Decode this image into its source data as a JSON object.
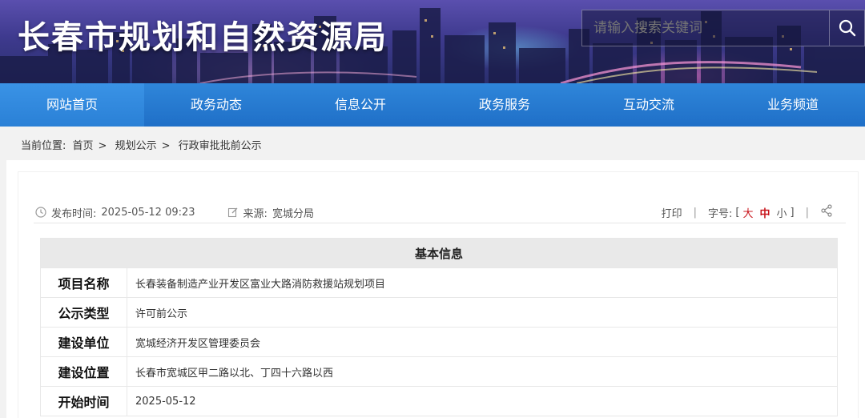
{
  "header": {
    "site_title": "长春市规划和自然资源局",
    "search_placeholder": "请输入搜索关键词"
  },
  "nav": {
    "items": [
      {
        "label": "网站首页",
        "active": true
      },
      {
        "label": "政务动态"
      },
      {
        "label": "信息公开"
      },
      {
        "label": "政务服务"
      },
      {
        "label": "互动交流"
      },
      {
        "label": "业务频道"
      }
    ]
  },
  "breadcrumb": {
    "prefix": "当前位置:",
    "items": [
      "首页",
      "规划公示",
      "行政审批批前公示"
    ],
    "separator": ">"
  },
  "meta": {
    "publish_label": "发布时间:",
    "publish_time": "2025-05-12 09:23",
    "source_label": "来源:",
    "source": "宽城分局",
    "print": "打印",
    "fontsize_label": "字号:",
    "bracket_open": "[",
    "size_large": "大",
    "size_medium": "中",
    "size_small": "小",
    "bracket_close": "]",
    "divider": "|"
  },
  "table": {
    "heading": "基本信息",
    "rows": [
      {
        "label": "项目名称",
        "value": "长春装备制造产业开发区富业大路消防救援站规划项目"
      },
      {
        "label": "公示类型",
        "value": "许可前公示"
      },
      {
        "label": "建设单位",
        "value": "宽城经济开发区管理委员会"
      },
      {
        "label": "建设位置",
        "value": "长春市宽城区甲二路以北、丁四十六路以西"
      },
      {
        "label": "开始时间",
        "value": "2025-05-12"
      }
    ]
  },
  "colors": {
    "nav": "#2a80d6",
    "accent_red": "#c8161d",
    "table_header": "#e9e9e9"
  },
  "icons": {
    "search": "search-icon",
    "clock": "clock-icon",
    "edit": "edit-icon",
    "share": "share-icon"
  }
}
